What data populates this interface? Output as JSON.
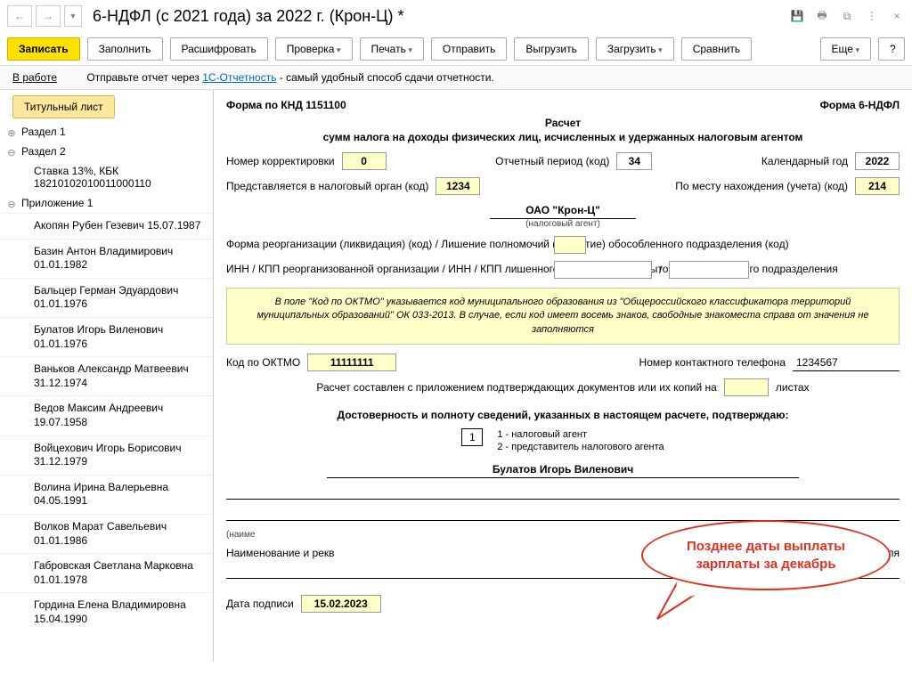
{
  "title": "6-НДФЛ (с 2021 года) за 2022 г. (Крон-Ц) *",
  "toolbar": {
    "write": "Записать",
    "fill": "Заполнить",
    "decode": "Расшифровать",
    "check": "Проверка",
    "print": "Печать",
    "send": "Отправить",
    "upload": "Выгрузить",
    "download": "Загрузить",
    "compare": "Сравнить",
    "more": "Еще",
    "help": "?"
  },
  "infobar": {
    "status": "В работе",
    "prefix": "Отправьте отчет через ",
    "link": "1С-Отчетность",
    "suffix": " - самый удобный способ сдачи отчетности."
  },
  "sidebar": {
    "active_tab": "Титульный лист",
    "section1": "Раздел 1",
    "section2": "Раздел 2",
    "rate": "Ставка 13%, КБК 18210102010011000110",
    "appendix": "Приложение 1",
    "persons": [
      "Акопян Рубен Гезевич 15.07.1987",
      "Базин Антон Владимирович 01.01.1982",
      "Бальцер Герман Эдуардович 01.01.1976",
      "Булатов Игорь Виленович 01.01.1976",
      "Ваньков Александр Матвеевич 31.12.1974",
      "Ведов Максим Андреевич 19.07.1958",
      "Войцехович Игорь Борисович 31.12.1979",
      "Волина Ирина Валерьевна 04.05.1991",
      "Волков Марат Савельевич 01.01.1986",
      "Габровская Светлана Марковна 01.01.1978",
      "Гордина Елена Владимировна 15.04.1990"
    ]
  },
  "form": {
    "knd": "Форма по КНД 1151100",
    "form_name": "Форма 6-НДФЛ",
    "title1": "Расчет",
    "title2": "сумм налога на доходы физических лиц, исчисленных и удержанных налоговым агентом",
    "corr_lbl": "Номер корректировки",
    "corr": "0",
    "period_lbl": "Отчетный период (код)",
    "period": "34",
    "year_lbl": "Календарный год",
    "year": "2022",
    "tax_org_lbl": "Представляется в налоговый орган (код)",
    "tax_org": "1234",
    "loc_lbl": "По месту нахождения (учета) (код)",
    "loc": "214",
    "org": "ОАО \"Крон-Ц\"",
    "org_cap": "(налоговый агент)",
    "reorg_lbl": "Форма реорганизации (ликвидация) (код) / Лишение полномочий (закрытие) обособленного подразделения (код)",
    "inn_lbl": "ИНН / КПП реорганизованной организации / ИНН / КПП лишенного полномочий (закрытого) обособленного подразделения",
    "note": "В поле \"Код по ОКТМО\" указывается код муниципального образования из \"Общероссийского классификатора территорий муниципальных образований\" ОК 033-2013. В случае, если код имеет восемь знаков, свободные знакоместа справа от значения не заполняются",
    "oktmo_lbl": "Код по ОКТМО",
    "oktmo": "11111111",
    "phone_lbl": "Номер контактного телефона",
    "phone": "1234567",
    "sheets_lbl1": "Расчет составлен с приложением подтверждающих документов или их копий на",
    "sheets_lbl2": "листах",
    "confirm_title": "Достоверность и полноту сведений, указанных в настоящем расчете, подтверждаю:",
    "opt_val": "1",
    "opt1": "1 - налоговый агент",
    "opt2": "2 - представитель налогового агента",
    "signer": "Булатов Игорь Виленович",
    "rep_cap1": "(наиме",
    "rep_cap2": "Наименование и рекв",
    "rep_cap3": "дставителя",
    "date_lbl": "Дата подписи",
    "date": "15.02.2023"
  },
  "callout": "Позднее даты выплаты зарплаты за декабрь"
}
